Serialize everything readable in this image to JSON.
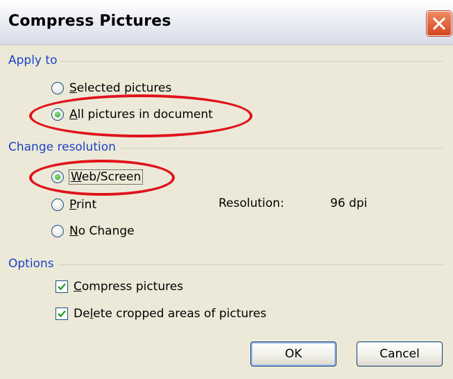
{
  "window": {
    "title": "Compress Pictures",
    "close_icon": "close-icon"
  },
  "apply_to": {
    "label": "Apply to",
    "options": [
      {
        "prefix": "",
        "accel": "S",
        "rest": "elected pictures",
        "checked": false
      },
      {
        "prefix": "",
        "accel": "A",
        "rest": "ll pictures in document",
        "checked": true
      }
    ]
  },
  "change_resolution": {
    "label": "Change resolution",
    "options": [
      {
        "prefix": "",
        "accel": "W",
        "rest": "eb/Screen",
        "checked": true
      },
      {
        "prefix": "",
        "accel": "P",
        "rest": "rint",
        "checked": false
      },
      {
        "prefix": "",
        "accel": "N",
        "rest": "o Change",
        "checked": false
      }
    ],
    "resolution_label": "Resolution:",
    "resolution_value": "96 dpi"
  },
  "options_group": {
    "label": "Options",
    "checkboxes": [
      {
        "prefix": "",
        "accel": "C",
        "rest": "ompress pictures",
        "checked": true
      },
      {
        "prefix": "De",
        "accel": "l",
        "rest": "ete cropped areas of pictures",
        "checked": true
      }
    ]
  },
  "buttons": {
    "ok": "OK",
    "cancel": "Cancel"
  },
  "annotation": {
    "ellipse_color": "#e0131b"
  }
}
